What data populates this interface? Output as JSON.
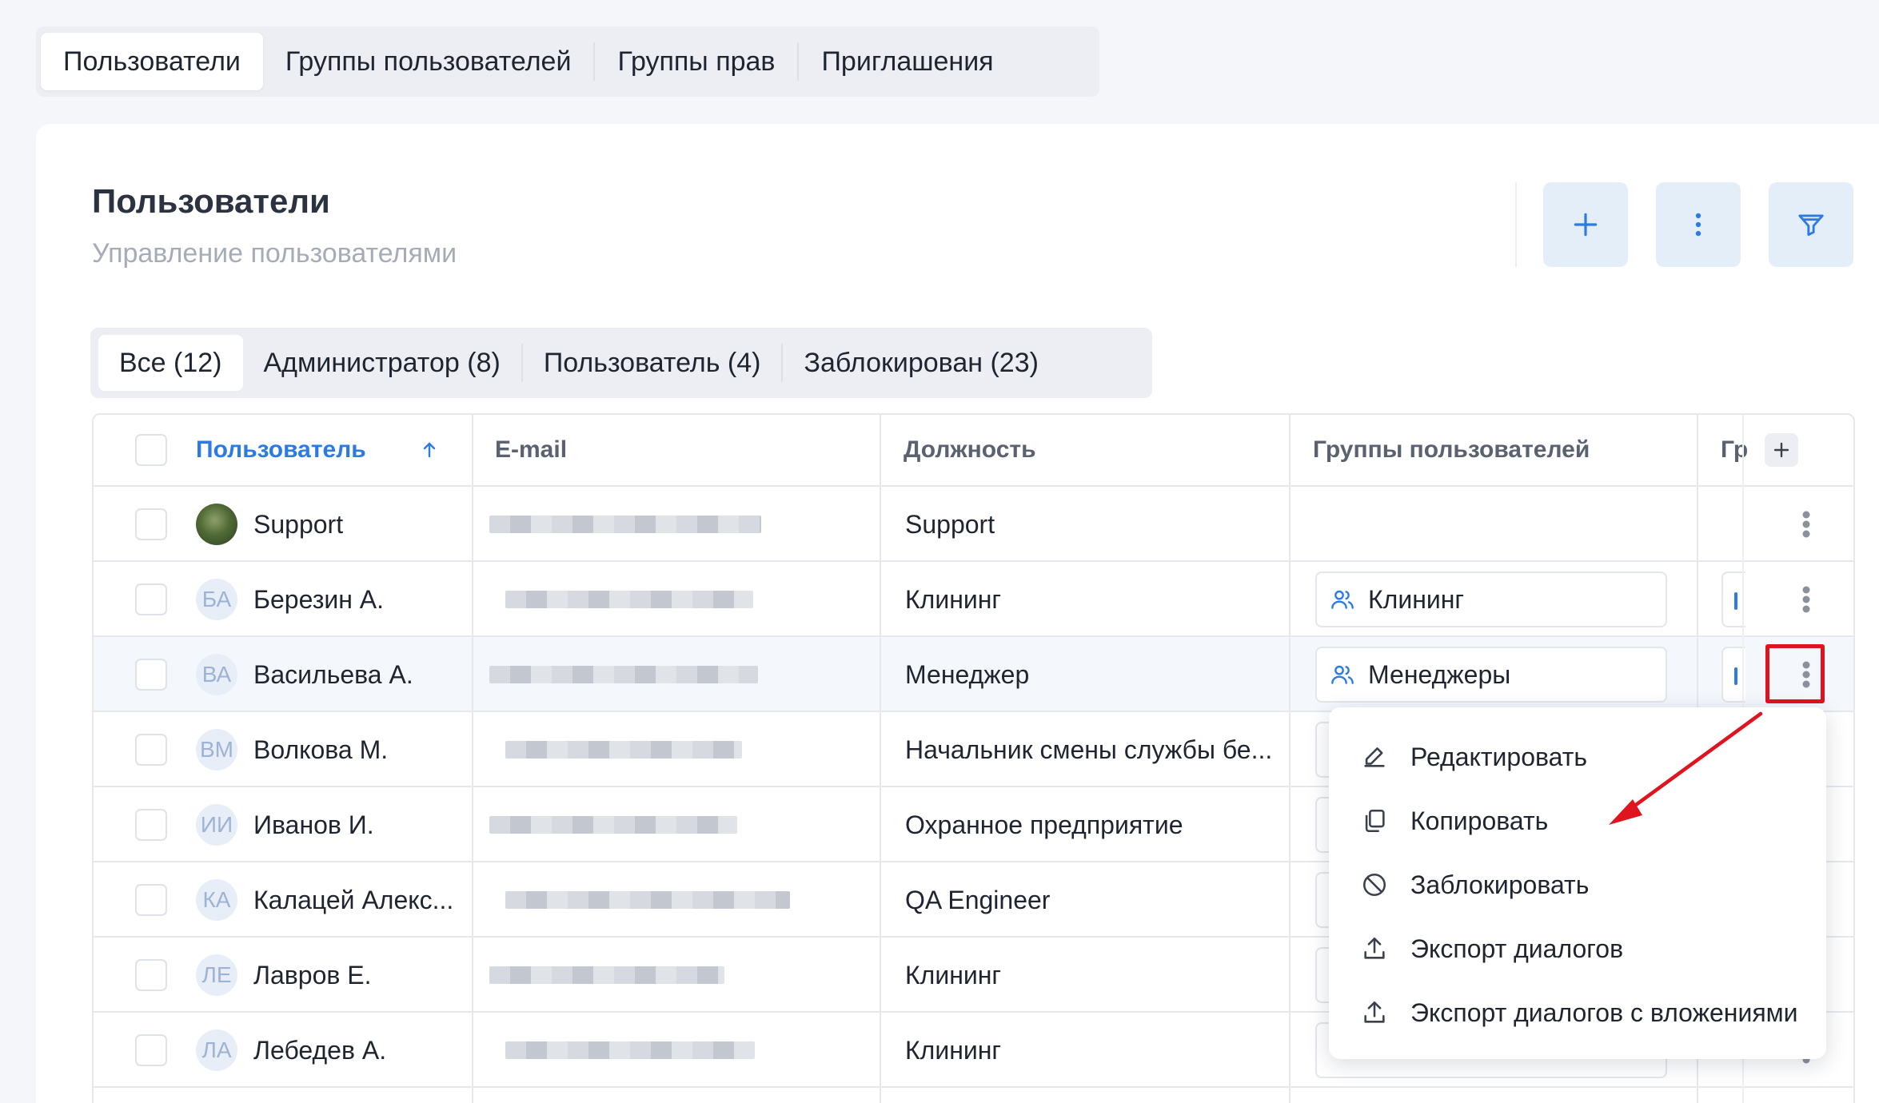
{
  "top_tabs": [
    {
      "label": "Пользователи",
      "active": true
    },
    {
      "label": "Группы пользователей"
    },
    {
      "label": "Группы прав"
    },
    {
      "label": "Приглашения"
    }
  ],
  "header": {
    "title": "Пользователи",
    "subtitle": "Управление пользователями",
    "actions": [
      "plus-icon",
      "more-vertical-icon",
      "filter-icon"
    ]
  },
  "filter_tabs": [
    {
      "label": "Все (12)",
      "active": true
    },
    {
      "label": "Администратор (8)"
    },
    {
      "label": "Пользователь (4)"
    },
    {
      "label": "Заблокирован (23)"
    }
  ],
  "table": {
    "columns": {
      "user": "Пользователь",
      "email": "E-mail",
      "position": "Должность",
      "groups": "Группы пользователей",
      "rights": "Гр"
    },
    "sort_column": "user",
    "sort_direction": "asc",
    "rows": [
      {
        "initials": "",
        "name": "Support",
        "position": "Support",
        "group": ""
      },
      {
        "initials": "БА",
        "name": "Березин А.",
        "position": "Клининг",
        "group": "Клининг"
      },
      {
        "initials": "ВА",
        "name": "Васильева А.",
        "position": "Менеджер",
        "group": "Менеджеры"
      },
      {
        "initials": "ВМ",
        "name": "Волкова М.",
        "position": "Начальник смены службы бе...",
        "group": ""
      },
      {
        "initials": "ИИ",
        "name": "Иванов И.",
        "position": "Охранное предприятие",
        "group": ""
      },
      {
        "initials": "КА",
        "name": "Калацей Алекс...",
        "position": "QA Engineer",
        "group": ""
      },
      {
        "initials": "ЛЕ",
        "name": "Лавров Е.",
        "position": "Клининг",
        "group": ""
      },
      {
        "initials": "ЛА",
        "name": "Лебедев А.",
        "position": "Клининг",
        "group": ""
      }
    ]
  },
  "row_menu": {
    "items": [
      {
        "label": "Редактировать",
        "icon": "edit-icon"
      },
      {
        "label": "Копировать",
        "icon": "copy-icon"
      },
      {
        "label": "Заблокировать",
        "icon": "block-icon"
      },
      {
        "label": "Экспорт диалогов",
        "icon": "upload-icon"
      },
      {
        "label": "Экспорт диалогов с вложениями",
        "icon": "upload-icon"
      }
    ]
  },
  "colors": {
    "accent": "#2c7be5",
    "annotation": "#e0141e",
    "button_bg": "#e4eef9"
  }
}
